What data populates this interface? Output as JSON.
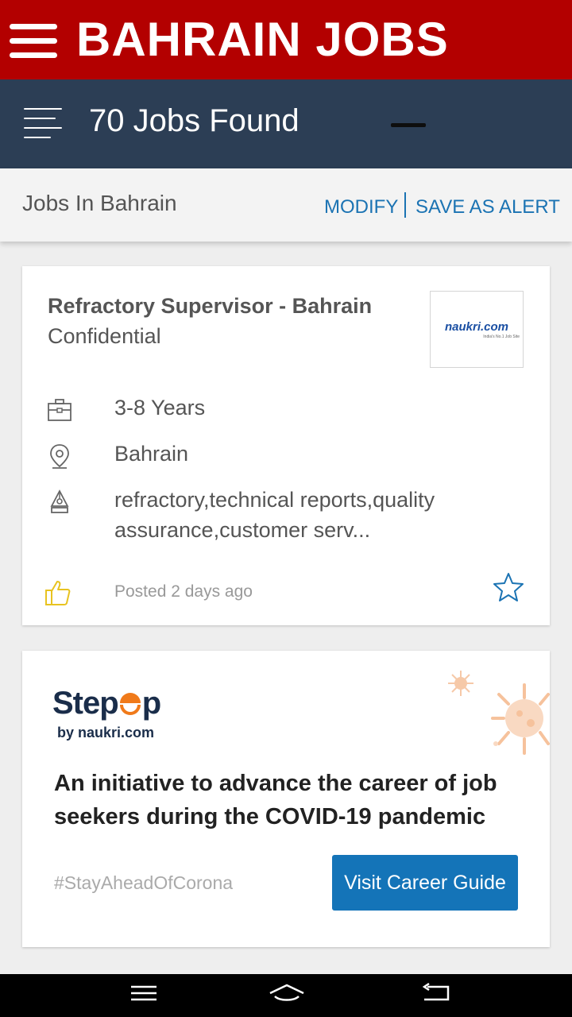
{
  "app": {
    "title": "BAHRAIN JOBS"
  },
  "header": {
    "jobs_found": "70 Jobs Found"
  },
  "context": {
    "label": "Jobs In Bahrain",
    "modify": "MODIFY",
    "save_alert": "SAVE AS ALERT"
  },
  "job": {
    "title": "Refractory Supervisor - Bahrain",
    "company": "Confidential",
    "logo_text": "naukri.com",
    "logo_tagline": "India's No.1 Job Site",
    "experience": "3-8 Years",
    "location": "Bahrain",
    "skills_line1": "refractory,technical reports,quality",
    "skills_line2": "assurance,customer serv...",
    "posted": "Posted 2 days ago"
  },
  "promo": {
    "brand_step": "Step",
    "brand_up": "p",
    "brand_by": "by naukri.com",
    "headline": "An initiative to advance the career of job seekers during the COVID-19 pandemic",
    "hashtag": "#StayAheadOfCorona",
    "button": "Visit Career Guide"
  },
  "colors": {
    "banner": "#b30000",
    "subbar": "#2c3e55",
    "link": "#1b73b3",
    "button": "#1474b8",
    "brand_orange": "#f07a1a"
  },
  "icons": [
    "menu-icon",
    "filter-list-icon",
    "minus-icon",
    "briefcase-icon",
    "location-pin-icon",
    "pen-nib-icon",
    "thumbs-up-icon",
    "star-outline-icon",
    "virus-icon",
    "nav-menu-icon",
    "nav-home-icon",
    "nav-back-icon"
  ]
}
